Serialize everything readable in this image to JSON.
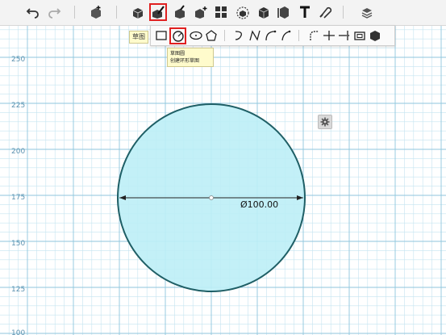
{
  "toolbar": {
    "icons": [
      "undo-icon",
      "redo-icon",
      "add-box-icon",
      "primitives-icon",
      "sketch-icon",
      "construct-icon",
      "modify-icon",
      "pattern-icon",
      "grouping-icon",
      "combine-icon",
      "measure-icon",
      "text-icon",
      "snap-icon",
      "material-icon"
    ]
  },
  "sketch_panel": {
    "label": "草图",
    "tools": [
      "rectangle-icon",
      "circle-icon",
      "ellipse-icon",
      "polygon-icon",
      "polyline-icon",
      "spline-icon",
      "two-point-arc-icon",
      "three-point-arc-icon",
      "fillet-icon",
      "trim-icon",
      "extend-icon",
      "offset-icon",
      "project-icon"
    ]
  },
  "tooltip": {
    "title": "草图圆",
    "description": "创建环形草图"
  },
  "canvas": {
    "y_axis_labels": [
      "250",
      "225",
      "200",
      "175",
      "150",
      "125",
      "100"
    ],
    "dimension_label": "Ø100.00"
  },
  "colors": {
    "grid_minor": "#c5e4f0",
    "grid_major": "#8fc6dd",
    "circle_fill": "#bdeef6",
    "circle_stroke": "#1f5f66",
    "selection": "#e02020"
  }
}
